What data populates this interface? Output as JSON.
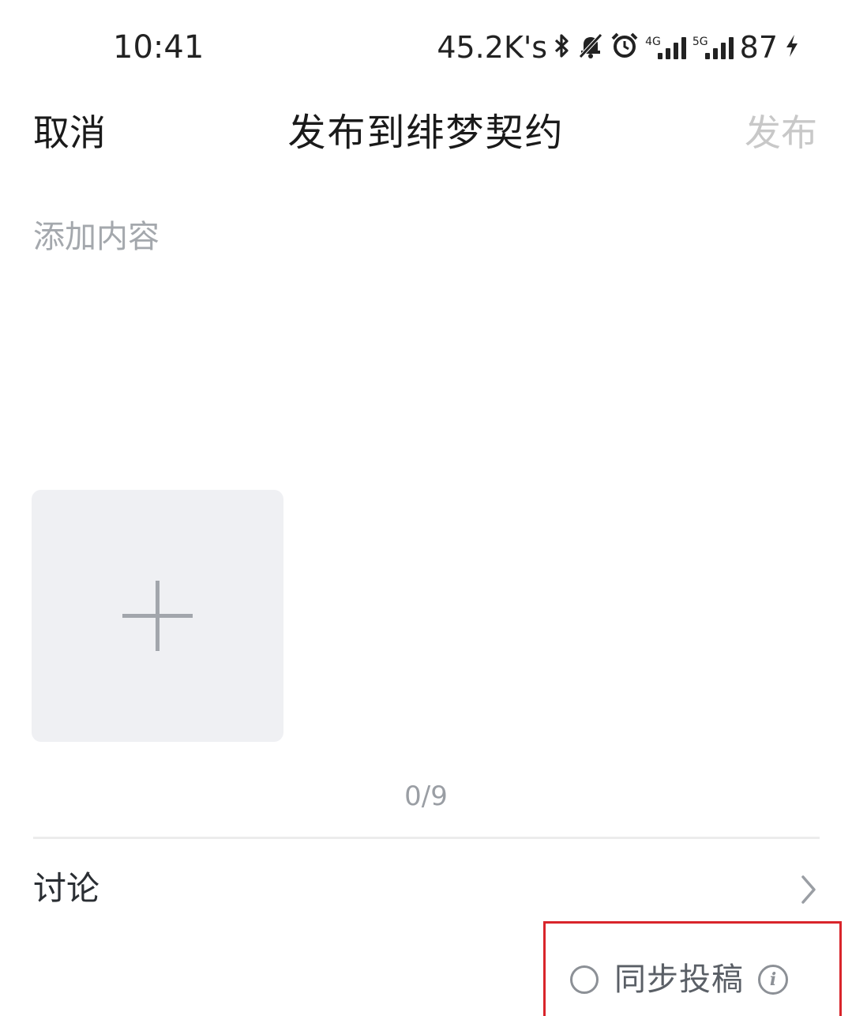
{
  "status_bar": {
    "time": "10:41",
    "net_speed": "45.2K's",
    "icons": [
      "bluetooth-icon",
      "mute-bell-icon",
      "alarm-icon",
      "signal-4g-icon",
      "signal-5g-icon",
      "charging-icon"
    ],
    "net_tag_1": "4G",
    "net_tag_2": "5G",
    "battery": "87"
  },
  "header": {
    "cancel_label": "取消",
    "title": "发布到绯梦契约",
    "publish_label": "发布"
  },
  "editor": {
    "placeholder": "添加内容",
    "value": ""
  },
  "images": {
    "count_label": "0/9"
  },
  "discussion": {
    "label": "讨论"
  },
  "sync": {
    "label": "同步投稿",
    "checked": false
  },
  "colors": {
    "publish_disabled": "#c8c8c8",
    "highlight_box": "#d9252b",
    "image_tile_bg": "#eff0f3"
  }
}
